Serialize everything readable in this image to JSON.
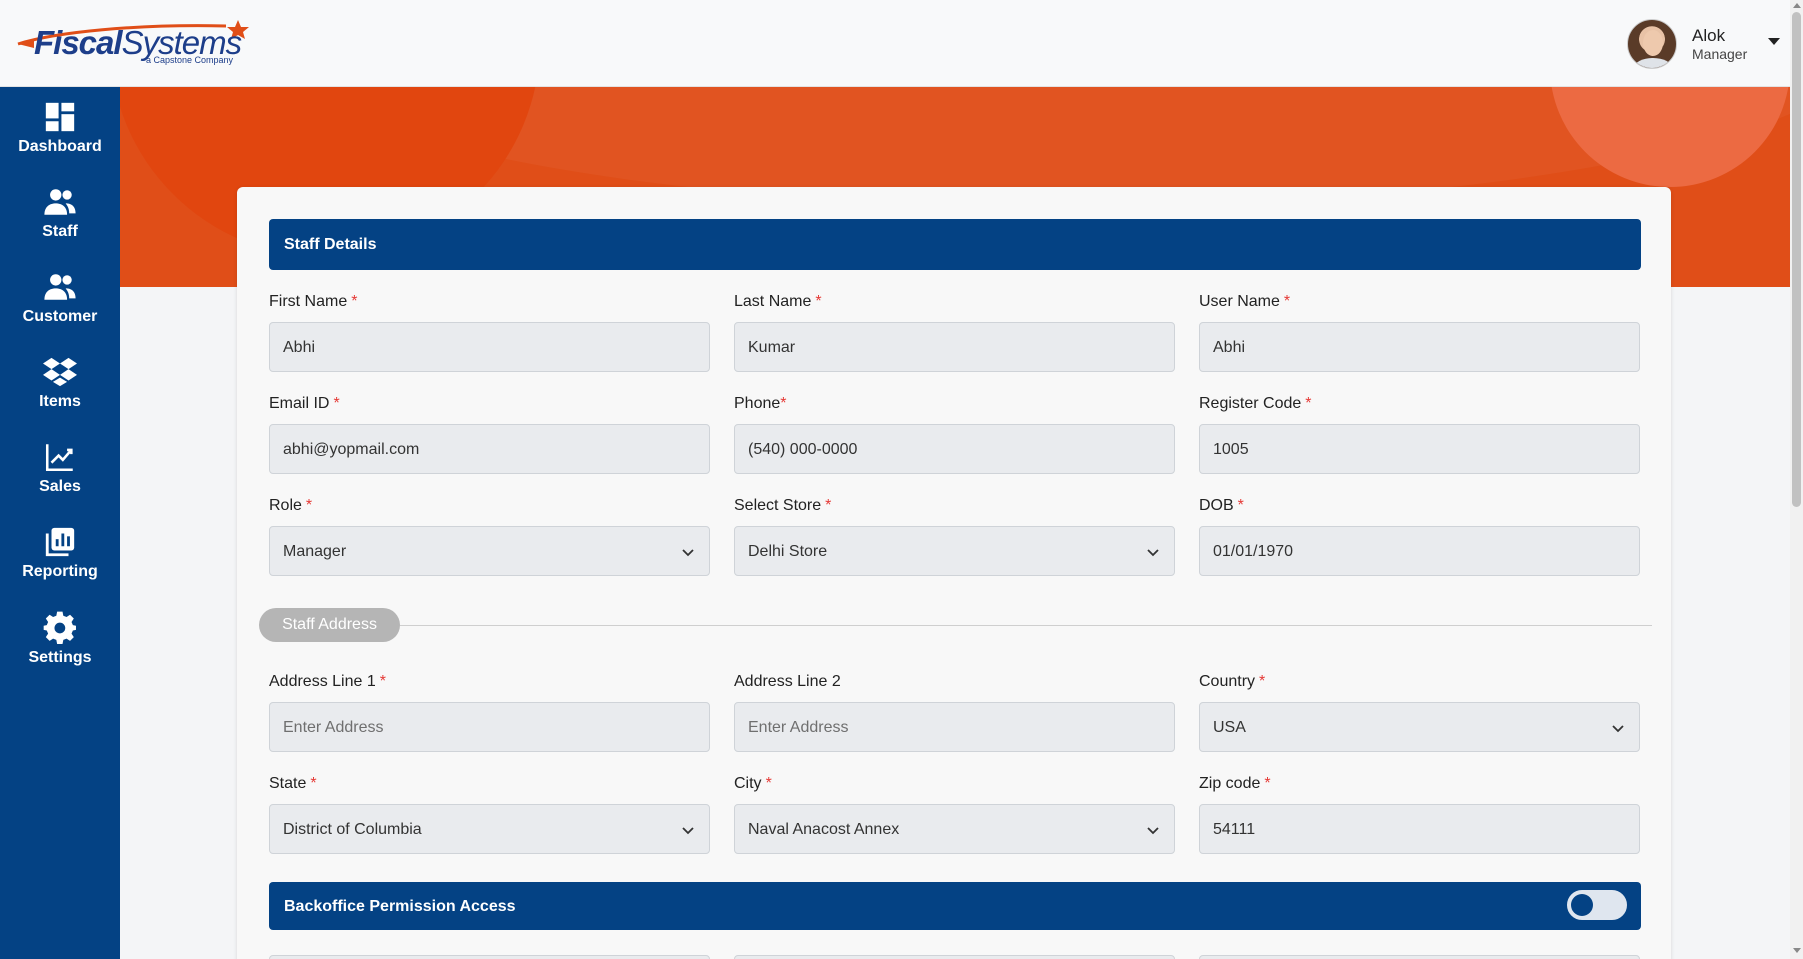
{
  "brand": {
    "name_bold": "Fiscal",
    "name_regular": "Systems",
    "tagline": "a Capstone Company"
  },
  "user": {
    "name": "Alok",
    "role": "Manager"
  },
  "sidebar": {
    "items": [
      {
        "label": "Dashboard",
        "icon": "dashboard-icon"
      },
      {
        "label": "Staff",
        "icon": "users-icon"
      },
      {
        "label": "Customer",
        "icon": "users-icon"
      },
      {
        "label": "Items",
        "icon": "layers-icon"
      },
      {
        "label": "Sales",
        "icon": "chart-line-icon"
      },
      {
        "label": "Reporting",
        "icon": "report-icon"
      },
      {
        "label": "Settings",
        "icon": "gear-icon"
      }
    ]
  },
  "form": {
    "staff_details_title": "Staff Details",
    "fields": {
      "first_name": {
        "label": "First Name",
        "value": "Abhi"
      },
      "last_name": {
        "label": "Last Name",
        "value": "Kumar"
      },
      "user_name": {
        "label": "User Name",
        "value": "Abhi"
      },
      "email": {
        "label": "Email ID",
        "value": "abhi@yopmail.com"
      },
      "phone": {
        "label": "Phone",
        "value": "(540) 000-0000"
      },
      "register_code": {
        "label": "Register Code",
        "value": "1005"
      },
      "role": {
        "label": "Role",
        "value": "Manager"
      },
      "store": {
        "label": "Select Store",
        "value": "Delhi Store"
      },
      "dob": {
        "label": "DOB",
        "value": "01/01/1970"
      }
    },
    "address_divider": "Staff Address",
    "address": {
      "line1": {
        "label": "Address Line 1",
        "placeholder": "Enter Address"
      },
      "line2": {
        "label": "Address Line 2",
        "placeholder": "Enter Address"
      },
      "country": {
        "label": "Country",
        "value": "USA"
      },
      "state": {
        "label": "State",
        "value": "District of Columbia"
      },
      "city": {
        "label": "City",
        "value": "Naval Anacost Annex"
      },
      "zip": {
        "label": "Zip code",
        "value": "54111"
      }
    },
    "permission_title": "Backoffice Permission Access",
    "permission_enabled": false,
    "required_mark": "*"
  },
  "colors": {
    "sidebar": "#044284",
    "banner": "#e04e18",
    "required": "#e53935",
    "section_header": "#044284"
  }
}
